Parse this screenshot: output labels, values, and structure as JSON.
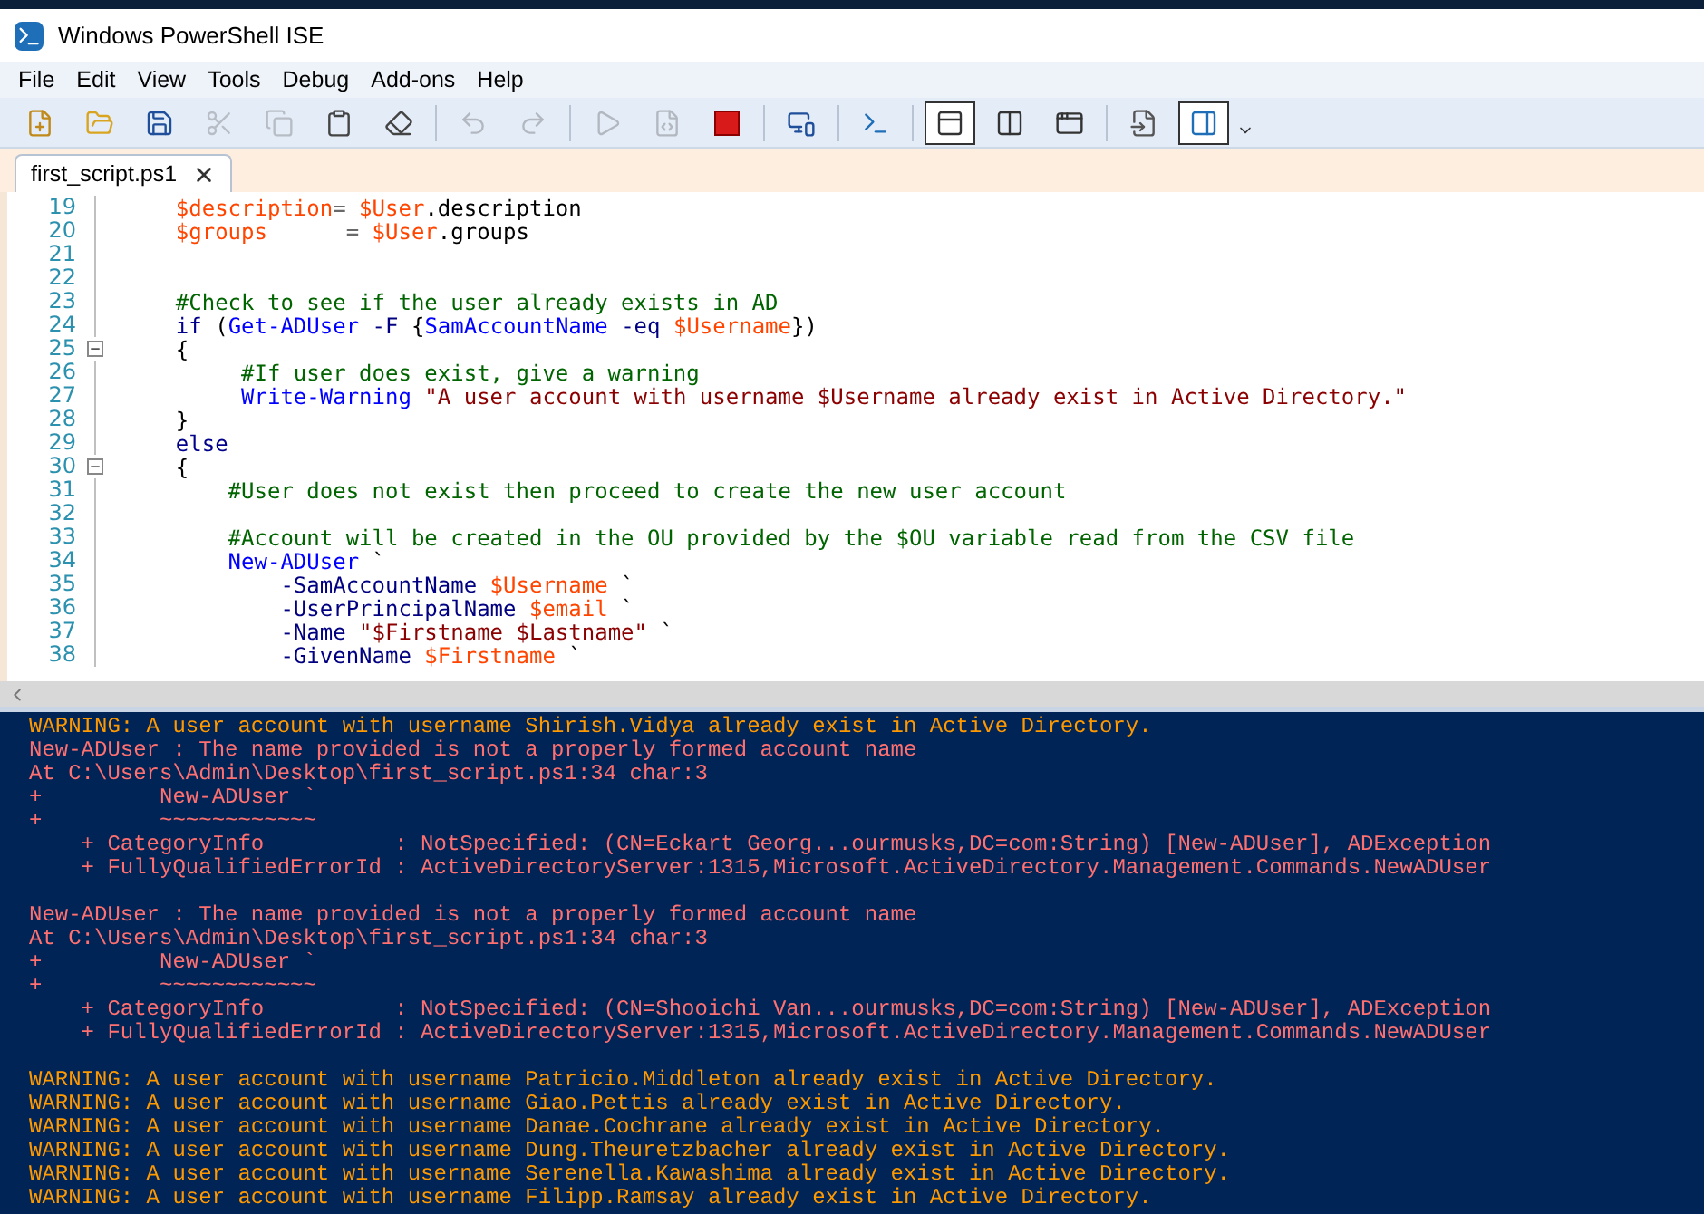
{
  "window": {
    "title": "Windows PowerShell ISE"
  },
  "menu": [
    "File",
    "Edit",
    "View",
    "Tools",
    "Debug",
    "Add-ons",
    "Help"
  ],
  "toolbar": [
    [
      {
        "kind": "new",
        "disabled": false,
        "selected": false
      },
      {
        "kind": "open",
        "disabled": false,
        "selected": false
      },
      {
        "kind": "save",
        "disabled": false,
        "selected": false
      },
      {
        "kind": "cut",
        "disabled": true,
        "selected": false
      },
      {
        "kind": "copy",
        "disabled": true,
        "selected": false
      },
      {
        "kind": "paste",
        "disabled": false,
        "selected": false
      },
      {
        "kind": "clear",
        "disabled": false,
        "selected": false
      }
    ],
    [
      {
        "kind": "undo",
        "disabled": true,
        "selected": false
      },
      {
        "kind": "redo",
        "disabled": true,
        "selected": false
      }
    ],
    [
      {
        "kind": "run",
        "disabled": true,
        "selected": false
      },
      {
        "kind": "runsel",
        "disabled": true,
        "selected": false
      },
      {
        "kind": "stop",
        "disabled": false,
        "selected": false
      }
    ],
    [
      {
        "kind": "remote",
        "disabled": false,
        "selected": false
      }
    ],
    [
      {
        "kind": "console",
        "disabled": false,
        "selected": false
      }
    ],
    [
      {
        "kind": "paneTop",
        "disabled": false,
        "selected": true
      },
      {
        "kind": "paneRight",
        "disabled": false,
        "selected": false
      },
      {
        "kind": "paneMax",
        "disabled": false,
        "selected": false
      }
    ],
    [
      {
        "kind": "snippet",
        "disabled": false,
        "selected": false
      },
      {
        "kind": "addon",
        "disabled": false,
        "selected": true
      }
    ]
  ],
  "tabs": [
    {
      "label": "first_script.ps1",
      "selected": true
    }
  ],
  "editor": {
    "lines": [
      {
        "number": "19",
        "fold": false,
        "tokens": [
          {
            "kind": "var",
            "text": "    $description"
          },
          {
            "kind": "op",
            "text": "="
          },
          {
            "kind": "var",
            "text": " $User"
          },
          {
            "kind": "plain",
            "text": ".description"
          }
        ]
      },
      {
        "number": "20",
        "fold": false,
        "tokens": [
          {
            "kind": "var",
            "text": "    $groups"
          },
          {
            "kind": "op",
            "text": "      = "
          },
          {
            "kind": "var",
            "text": "$User"
          },
          {
            "kind": "plain",
            "text": ".groups"
          }
        ]
      },
      {
        "number": "21",
        "fold": false
      },
      {
        "number": "22",
        "fold": false
      },
      {
        "number": "23",
        "fold": false,
        "tokens": [
          {
            "kind": "comment",
            "text": "    #Check to see if the user already exists in AD"
          }
        ]
      },
      {
        "number": "24",
        "fold": false,
        "tokens": [
          {
            "kind": "keyword",
            "text": "    if"
          },
          {
            "kind": "plain",
            "text": " ("
          },
          {
            "kind": "command",
            "text": "Get-ADUser"
          },
          {
            "kind": "param",
            "text": " -F "
          },
          {
            "kind": "plain",
            "text": "{"
          },
          {
            "kind": "command",
            "text": "SamAccountName"
          },
          {
            "kind": "param",
            "text": " -eq "
          },
          {
            "kind": "var",
            "text": "$Username"
          },
          {
            "kind": "plain",
            "text": "})"
          }
        ]
      },
      {
        "number": "25",
        "fold": true,
        "tokens": [
          {
            "kind": "plain",
            "text": "    {"
          }
        ]
      },
      {
        "number": "26",
        "fold": false,
        "tokens": [
          {
            "kind": "comment",
            "text": "         #If user does exist, give a warning"
          }
        ]
      },
      {
        "number": "27",
        "fold": false,
        "tokens": [
          {
            "kind": "command",
            "text": "         Write-Warning"
          },
          {
            "kind": "string",
            "text": " \"A user account with username $Username already exist in Active Directory.\""
          }
        ]
      },
      {
        "number": "28",
        "fold": false,
        "tokens": [
          {
            "kind": "plain",
            "text": "    }"
          }
        ]
      },
      {
        "number": "29",
        "fold": false,
        "tokens": [
          {
            "kind": "keyword",
            "text": "    else"
          }
        ]
      },
      {
        "number": "30",
        "fold": true,
        "tokens": [
          {
            "kind": "plain",
            "text": "    {"
          }
        ]
      },
      {
        "number": "31",
        "fold": false,
        "tokens": [
          {
            "kind": "comment",
            "text": "        #User does not exist then proceed to create the new user account"
          }
        ]
      },
      {
        "number": "32",
        "fold": false
      },
      {
        "number": "33",
        "fold": false,
        "tokens": [
          {
            "kind": "comment",
            "text": "        #Account will be created in the OU provided by the $OU variable read from the CSV file"
          }
        ]
      },
      {
        "number": "34",
        "fold": false,
        "tokens": [
          {
            "kind": "command",
            "text": "        New-ADUser"
          },
          {
            "kind": "plain",
            "text": " `"
          }
        ]
      },
      {
        "number": "35",
        "fold": false,
        "tokens": [
          {
            "kind": "param",
            "text": "            -SamAccountName"
          },
          {
            "kind": "var",
            "text": " $Username"
          },
          {
            "kind": "plain",
            "text": " `"
          }
        ]
      },
      {
        "number": "36",
        "fold": false,
        "tokens": [
          {
            "kind": "param",
            "text": "            -UserPrincipalName"
          },
          {
            "kind": "var",
            "text": " $email"
          },
          {
            "kind": "plain",
            "text": " `"
          }
        ]
      },
      {
        "number": "37",
        "fold": false,
        "tokens": [
          {
            "kind": "param",
            "text": "            -Name"
          },
          {
            "kind": "string",
            "text": " \"$Firstname $Lastname\""
          },
          {
            "kind": "plain",
            "text": " `"
          }
        ]
      },
      {
        "number": "38",
        "fold": false,
        "tokens": [
          {
            "kind": "param",
            "text": "            -GivenName"
          },
          {
            "kind": "var",
            "text": " $Firstname"
          },
          {
            "kind": "plain",
            "text": " `"
          }
        ]
      }
    ]
  },
  "console": {
    "lines": [
      {
        "kind": "warning",
        "text": "WARNING: A user account with username Shirish.Vidya already exist in Active Directory."
      },
      {
        "kind": "error",
        "text": "New-ADUser : The name provided is not a properly formed account name"
      },
      {
        "kind": "error",
        "text": "At C:\\Users\\Admin\\Desktop\\first_script.ps1:34 char:3"
      },
      {
        "kind": "error",
        "text": "+         New-ADUser `"
      },
      {
        "kind": "error",
        "text": "+         ~~~~~~~~~~~~"
      },
      {
        "kind": "error",
        "text": "    + CategoryInfo          : NotSpecified: (CN=Eckart Georg...ourmusks,DC=com:String) [New-ADUser], ADException"
      },
      {
        "kind": "error",
        "text": "    + FullyQualifiedErrorId : ActiveDirectoryServer:1315,Microsoft.ActiveDirectory.Management.Commands.NewADUser"
      },
      {
        "kind": "blank"
      },
      {
        "kind": "error",
        "text": "New-ADUser : The name provided is not a properly formed account name"
      },
      {
        "kind": "error",
        "text": "At C:\\Users\\Admin\\Desktop\\first_script.ps1:34 char:3"
      },
      {
        "kind": "error",
        "text": "+         New-ADUser `"
      },
      {
        "kind": "error",
        "text": "+         ~~~~~~~~~~~~"
      },
      {
        "kind": "error",
        "text": "    + CategoryInfo          : NotSpecified: (CN=Shooichi Van...ourmusks,DC=com:String) [New-ADUser], ADException"
      },
      {
        "kind": "error",
        "text": "    + FullyQualifiedErrorId : ActiveDirectoryServer:1315,Microsoft.ActiveDirectory.Management.Commands.NewADUser"
      },
      {
        "kind": "blank"
      },
      {
        "kind": "warning",
        "text": "WARNING: A user account with username Patricio.Middleton already exist in Active Directory."
      },
      {
        "kind": "warning",
        "text": "WARNING: A user account with username Giao.Pettis already exist in Active Directory."
      },
      {
        "kind": "warning",
        "text": "WARNING: A user account with username Danae.Cochrane already exist in Active Directory."
      },
      {
        "kind": "warning",
        "text": "WARNING: A user account with username Dung.Theuretzbacher already exist in Active Directory."
      },
      {
        "kind": "warning",
        "text": "WARNING: A user account with username Serenella.Kawashima already exist in Active Directory."
      },
      {
        "kind": "warning",
        "text": "WARNING: A user account with username Filipp.Ramsay already exist in Active Directory."
      }
    ]
  }
}
